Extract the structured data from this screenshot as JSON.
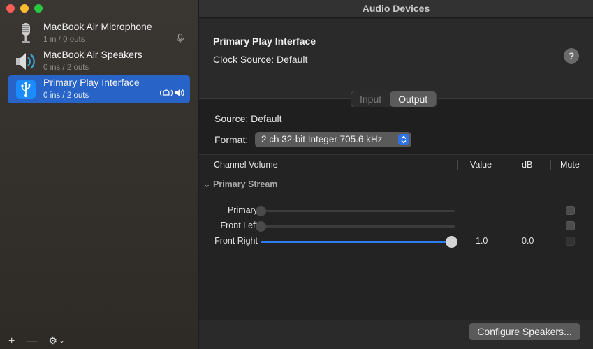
{
  "window": {
    "title": "Audio Devices"
  },
  "devices": [
    {
      "name": "MacBook Air Microphone",
      "io": "1 in / 0 outs",
      "icon": "microphone-icon",
      "selected": false
    },
    {
      "name": "MacBook Air Speakers",
      "io": "0 ins / 2 outs",
      "icon": "speaker-icon",
      "selected": false
    },
    {
      "name": "Primary Play Interface",
      "io": "0 ins / 2 outs",
      "icon": "usb-icon",
      "selected": true
    }
  ],
  "sidebar_toolbar": {
    "add": "+",
    "remove": "—",
    "gear": "⚙",
    "chevron": "⌄"
  },
  "detail": {
    "device_title": "Primary Play Interface",
    "clock_source": "Clock Source:  Default",
    "help": "?",
    "tabs": [
      {
        "label": "Input",
        "active": false
      },
      {
        "label": "Output",
        "active": true
      }
    ],
    "source": "Source:  Default",
    "format_label": "Format:",
    "format_value": "2 ch 32-bit Integer 705.6 kHz"
  },
  "table": {
    "headers": {
      "channel": "Channel Volume",
      "value": "Value",
      "db": "dB",
      "mute": "Mute"
    },
    "stream_name": "Primary Stream",
    "rows": [
      {
        "label": "Primary",
        "level": 0.0,
        "value": "",
        "db": "",
        "mute_enabled": true
      },
      {
        "label": "Front Left",
        "level": 0.0,
        "value": "",
        "db": "",
        "mute_enabled": true
      },
      {
        "label": "Front Right",
        "level": 1.0,
        "value": "1.0",
        "db": "0.0",
        "mute_enabled": false
      }
    ]
  },
  "footer": {
    "configure_label": "Configure Speakers..."
  },
  "colors": {
    "accent": "#2864c8",
    "slider_fill": "#2f7bf0"
  }
}
